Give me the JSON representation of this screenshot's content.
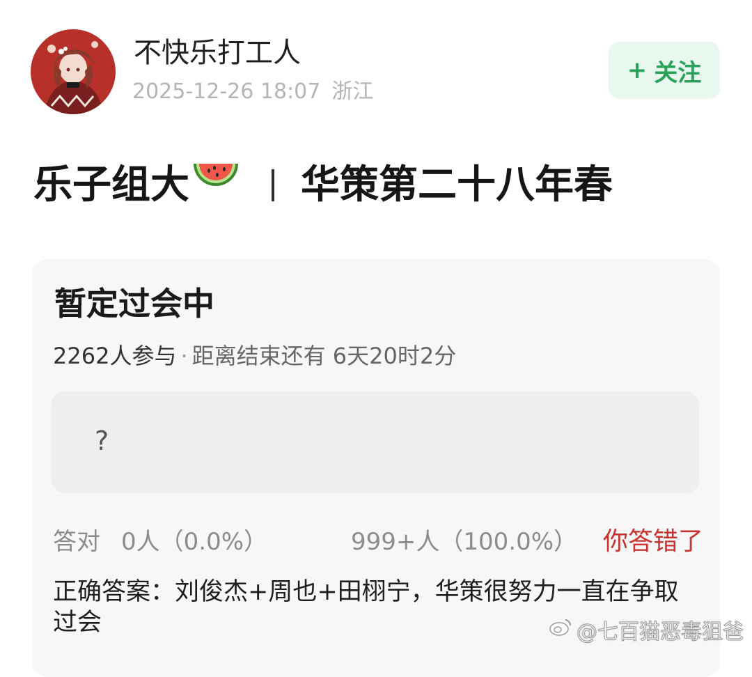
{
  "author": {
    "name": "不快乐打工人",
    "date": "2025-12-26 18:07",
    "location": "浙江",
    "avatar_icon": "anime-character-avatar"
  },
  "follow_button": {
    "plus": "+",
    "label": "关注",
    "color": "#2aa25a",
    "background": "#e9f8ee"
  },
  "post": {
    "title_left": "乐子组大",
    "title_emoji": "watermelon-icon",
    "title_right": "华策第二十八年春"
  },
  "quiz": {
    "title": "暂定过会中",
    "participants": "2262人参与",
    "separator": "·",
    "remaining": "距离结束还有 6天20时2分",
    "option_text": "?",
    "correct_label": "答对",
    "correct_value": "0人（0.0%）",
    "wrong_value": "999+人（100.0%）",
    "wrong_flag": "你答错了",
    "wrong_flag_color": "#c8332f",
    "explanation": "正确答案：刘俊杰+周也+田栩宁，华策很努力一直在争取过会"
  },
  "watermark": {
    "text": "@七百猫恶毒狙爸",
    "icon": "weibo-logo-icon"
  }
}
